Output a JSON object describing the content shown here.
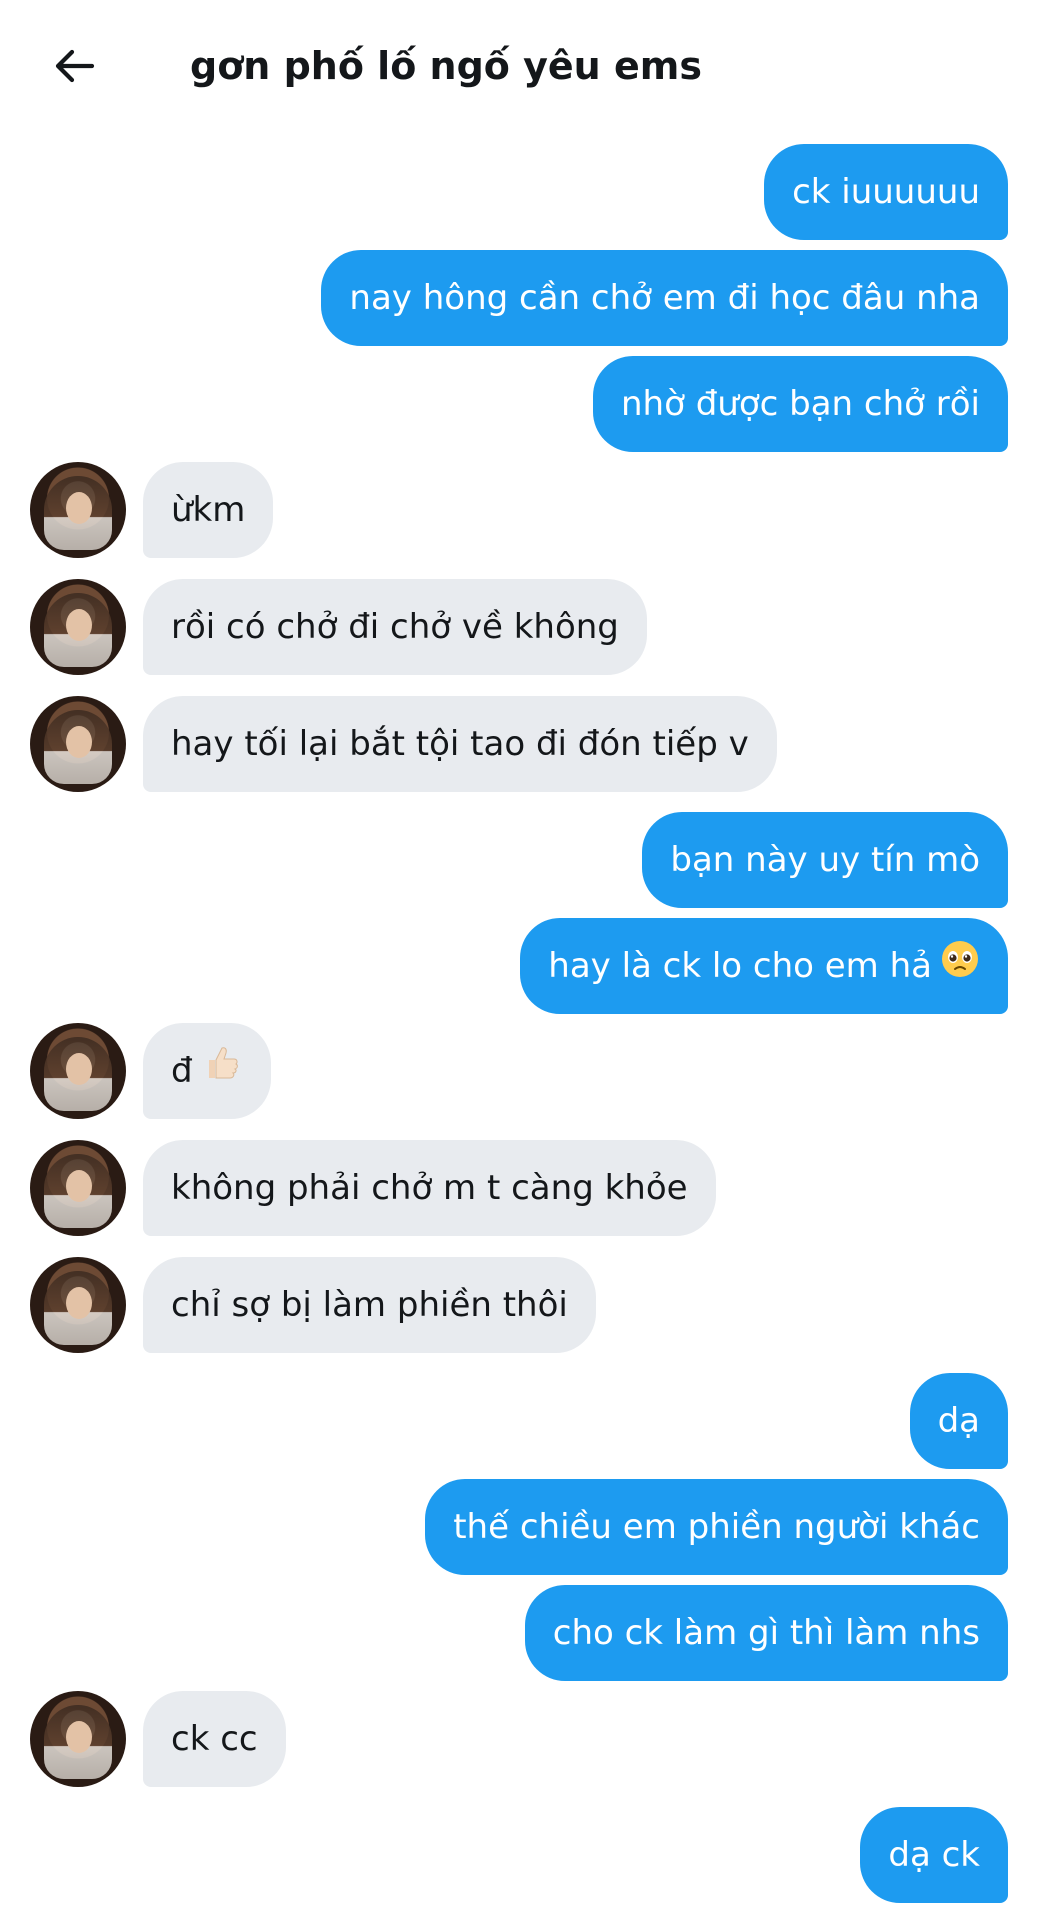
{
  "header": {
    "title": "gơn phố lố ngố yêu ems"
  },
  "messages": [
    {
      "from": "me",
      "text": "ck iuuuuuu"
    },
    {
      "from": "me",
      "text": "nay hông cần chở em đi học đâu nha"
    },
    {
      "from": "me",
      "text": "nhờ được bạn chở rồi"
    },
    {
      "from": "them",
      "text": "ừkm"
    },
    {
      "from": "them",
      "text": "rồi có chở đi chở về không"
    },
    {
      "from": "them",
      "text": "hay tối lại bắt tội tao đi đón tiếp v"
    },
    {
      "from": "me",
      "text": "bạn này uy tín mò"
    },
    {
      "from": "me",
      "text": "hay là ck lo cho em hả",
      "emoji": "pleading-face-icon"
    },
    {
      "from": "them",
      "text": "đ",
      "emoji": "thumbs-up-icon"
    },
    {
      "from": "them",
      "text": "không phải chở m t càng khỏe"
    },
    {
      "from": "them",
      "text": "chỉ sợ bị làm phiền thôi"
    },
    {
      "from": "me",
      "text": "dạ"
    },
    {
      "from": "me",
      "text": "thế chiều em phiền người khác"
    },
    {
      "from": "me",
      "text": "cho ck làm gì thì làm nhs"
    },
    {
      "from": "them",
      "text": "ck cc"
    },
    {
      "from": "me",
      "text": "dạ ck"
    }
  ],
  "colors": {
    "sent_bubble": "#1d9bf0",
    "received_bubble": "#e8ebef",
    "sent_text": "#ffffff",
    "received_text": "#14171a"
  }
}
